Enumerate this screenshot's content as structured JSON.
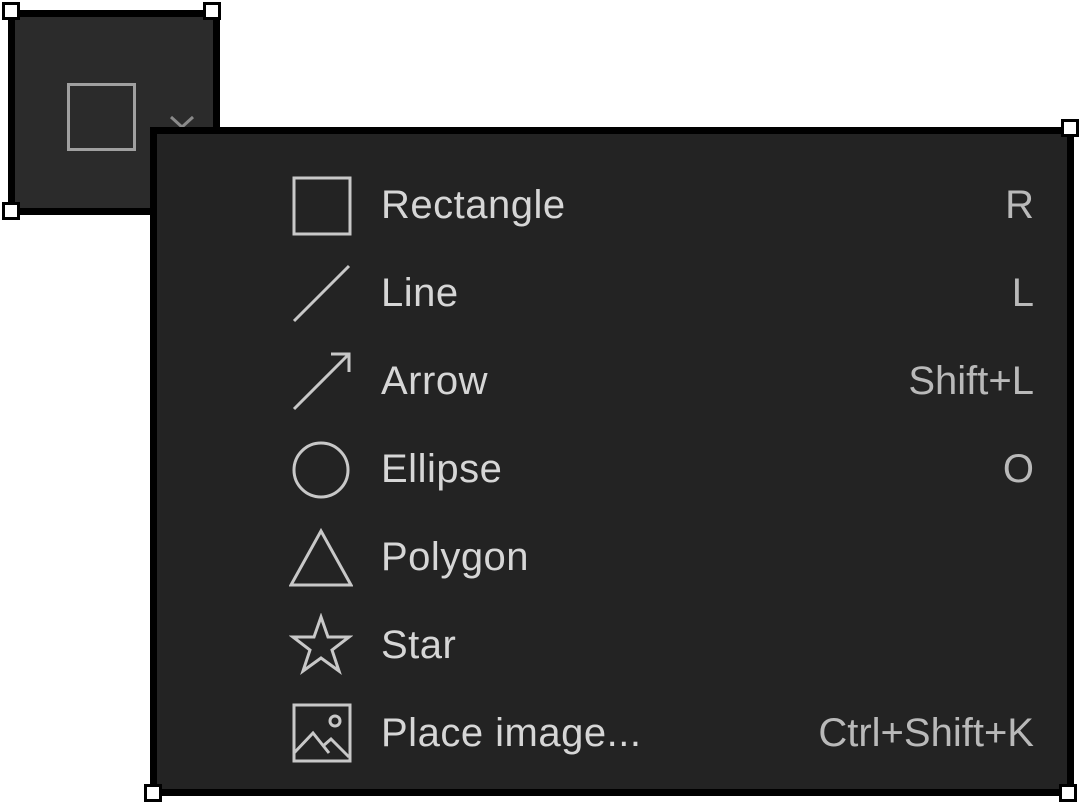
{
  "colors": {
    "menu_background": "#232323",
    "button_background": "#2b2b2b",
    "text": "#d6d6d6",
    "shortcut_text": "#b9b9b9",
    "icon_stroke": "#c8c8c8",
    "border": "#000000",
    "handle": "#ffffff"
  },
  "tool_button": {
    "icon": "rectangle-icon",
    "dropdown_icon": "chevron-down-icon"
  },
  "menu": {
    "items": [
      {
        "icon": "rectangle-icon",
        "label": "Rectangle",
        "shortcut": "R"
      },
      {
        "icon": "line-icon",
        "label": "Line",
        "shortcut": "L"
      },
      {
        "icon": "arrow-icon",
        "label": "Arrow",
        "shortcut": "Shift+L"
      },
      {
        "icon": "ellipse-icon",
        "label": "Ellipse",
        "shortcut": "O"
      },
      {
        "icon": "polygon-icon",
        "label": "Polygon",
        "shortcut": ""
      },
      {
        "icon": "star-icon",
        "label": "Star",
        "shortcut": ""
      },
      {
        "icon": "image-icon",
        "label": "Place image...",
        "shortcut": "Ctrl+Shift+K"
      }
    ]
  }
}
